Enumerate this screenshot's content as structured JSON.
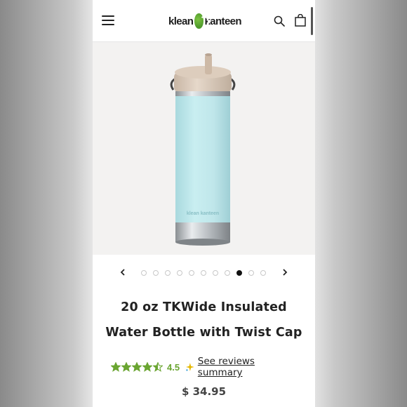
{
  "header": {
    "logo_text_left": "klean",
    "logo_text_right": "kanteen",
    "menu_icon": "hamburger-icon",
    "search_icon": "search-icon",
    "cart_icon": "shopping-bag-icon"
  },
  "gallery": {
    "image_alt": "Blue water bottle with twist cap",
    "bottle_color": "#bfe6ea",
    "cap_color": "#d9c8b8",
    "dot_count": 11,
    "active_index": 8,
    "prev_icon": "chevron-left-icon",
    "next_icon": "chevron-right-icon"
  },
  "product": {
    "title_line1": "20 oz TKWide Insulated",
    "title_line2": "Water Bottle with Twist Cap",
    "rating": "4.5",
    "rating_value": 4.5,
    "rating_max": 5,
    "reviews_link": "See reviews summary",
    "price": "$ 34.95"
  },
  "colors": {
    "accent_green": "#6aa531",
    "text_dark": "#222222"
  }
}
